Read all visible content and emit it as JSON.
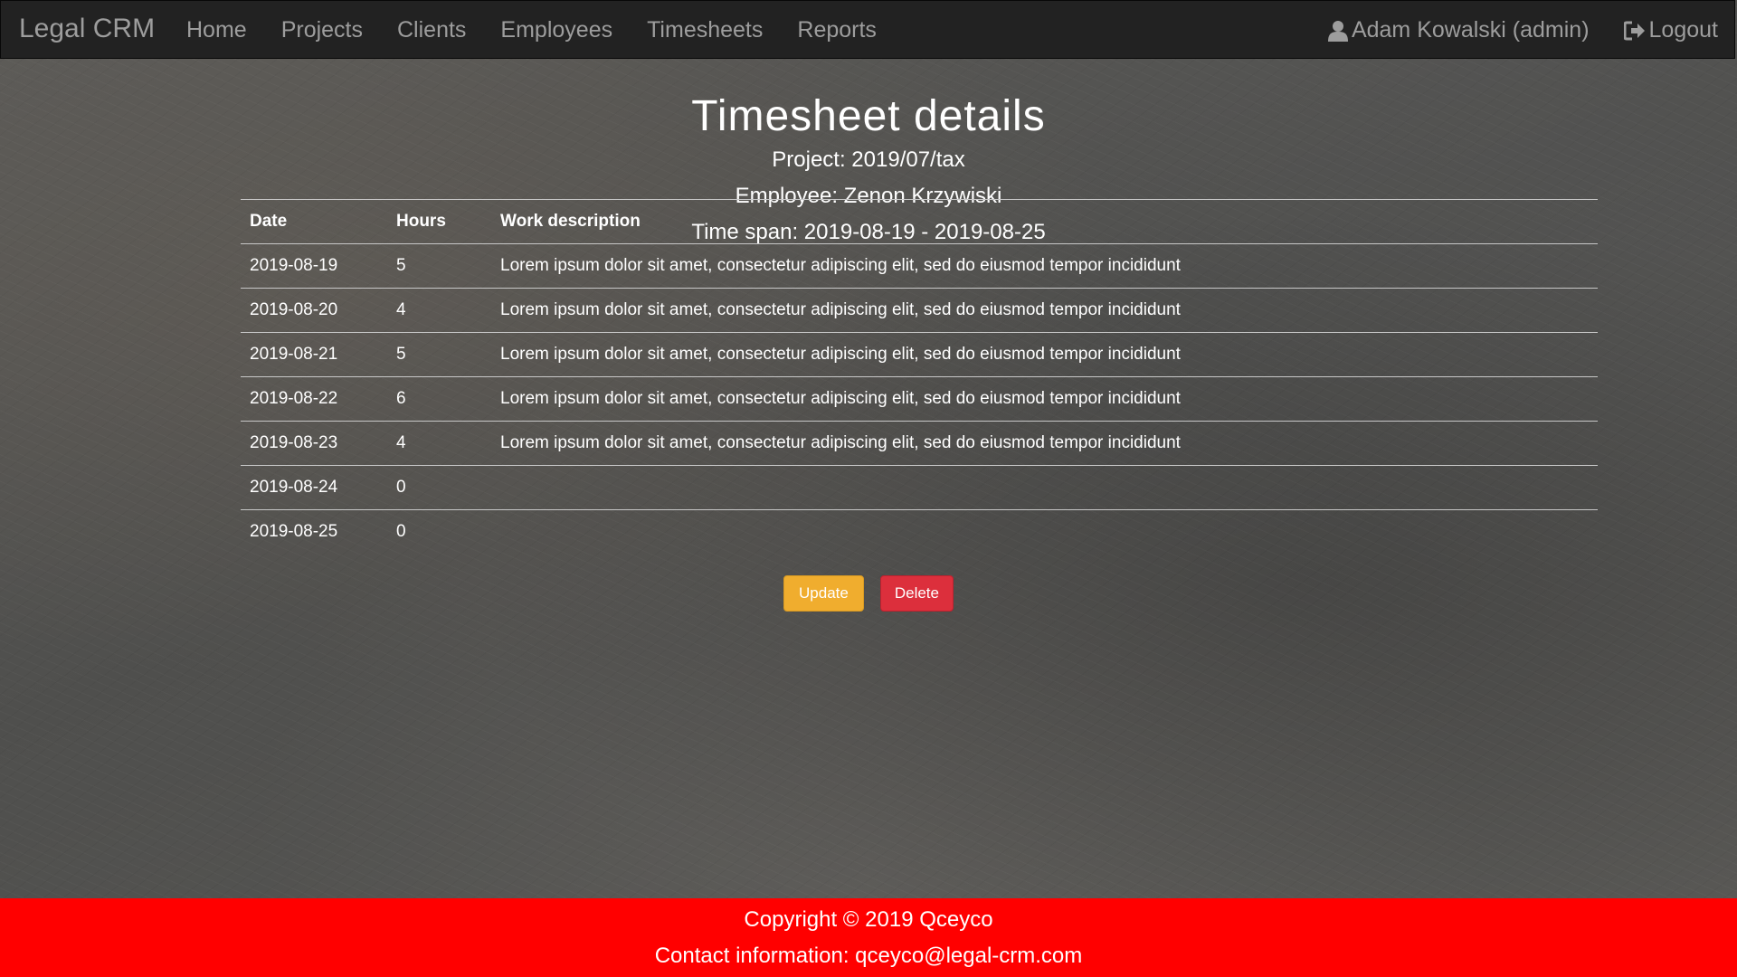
{
  "navbar": {
    "brand": "Legal CRM",
    "links": [
      "Home",
      "Projects",
      "Clients",
      "Employees",
      "Timesheets",
      "Reports"
    ],
    "user": "Adam Kowalski (admin)",
    "logout": "Logout"
  },
  "page": {
    "title": "Timesheet details",
    "project": "Project: 2019/07/tax",
    "employee": "Employee: Zenon Krzywiski",
    "time_span": "Time span: 2019-08-19 - 2019-08-25"
  },
  "table": {
    "headers": [
      "Date",
      "Hours",
      "Work description"
    ],
    "rows": [
      {
        "date": "2019-08-19",
        "hours": "5",
        "description": "Lorem ipsum dolor sit amet, consectetur adipiscing elit, sed do eiusmod tempor incididunt"
      },
      {
        "date": "2019-08-20",
        "hours": "4",
        "description": "Lorem ipsum dolor sit amet, consectetur adipiscing elit, sed do eiusmod tempor incididunt"
      },
      {
        "date": "2019-08-21",
        "hours": "5",
        "description": "Lorem ipsum dolor sit amet, consectetur adipiscing elit, sed do eiusmod tempor incididunt"
      },
      {
        "date": "2019-08-22",
        "hours": "6",
        "description": "Lorem ipsum dolor sit amet, consectetur adipiscing elit, sed do eiusmod tempor incididunt"
      },
      {
        "date": "2019-08-23",
        "hours": "4",
        "description": "Lorem ipsum dolor sit amet, consectetur adipiscing elit, sed do eiusmod tempor incididunt"
      },
      {
        "date": "2019-08-24",
        "hours": "0",
        "description": ""
      },
      {
        "date": "2019-08-25",
        "hours": "0",
        "description": ""
      }
    ]
  },
  "actions": {
    "update": "Update",
    "delete": "Delete"
  },
  "footer": {
    "copyright": "Copyright © 2019 Qceyco",
    "contact": "Contact information: qceyco@legal-crm.com"
  },
  "icons": {
    "user": "user-icon",
    "logout": "logout-icon"
  },
  "colors": {
    "navbar": "#222222",
    "footer": "#ff0000",
    "update": "#f0ad2e",
    "delete": "#dc2f3c"
  }
}
